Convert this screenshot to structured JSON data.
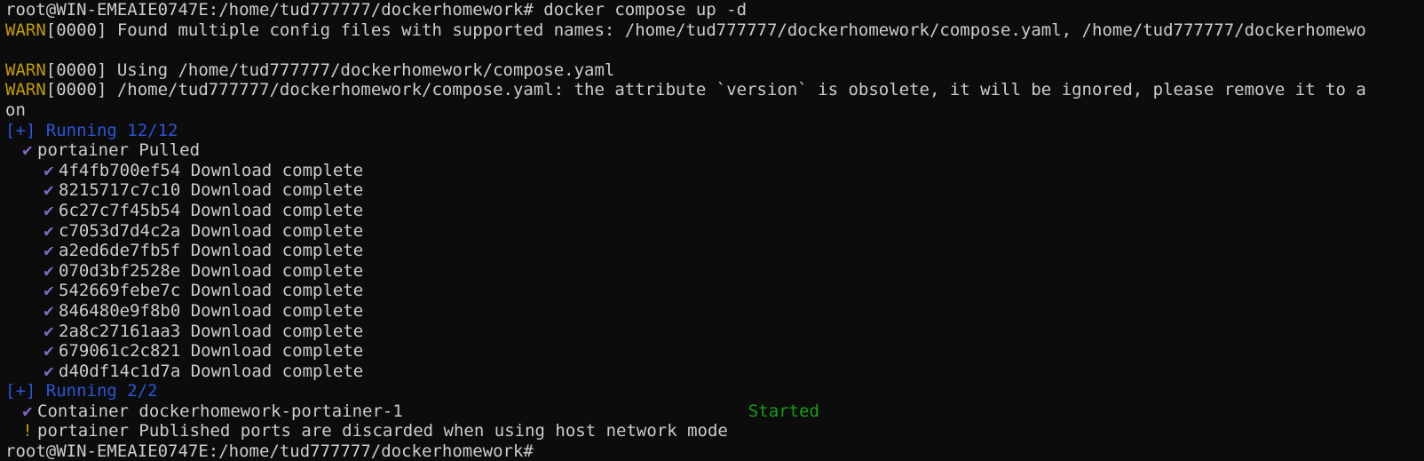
{
  "terminal": {
    "prompt": "root@WIN-EMEAIE0747E:/home/tud777777/dockerhomework#",
    "command": "docker compose up -d",
    "warn_label": "WARN",
    "warn_code": "[0000]",
    "warn1": "Found multiple config files with supported names: /home/tud777777/dockerhomework/compose.yaml, /home/tud777777/dockerhomewo",
    "warn2": "Using /home/tud777777/dockerhomework/compose.yaml",
    "warn3": "/home/tud777777/dockerhomework/compose.yaml: the attribute `version` is obsolete, it will be ignored, please remove it to a",
    "wrap": "on",
    "running1": "[+] Running 12/12",
    "pulled": "portainer Pulled",
    "layers": [
      {
        "id": "4f4fb700ef54",
        "status": "Download complete"
      },
      {
        "id": "8215717c7c10",
        "status": "Download complete"
      },
      {
        "id": "6c27c7f45b54",
        "status": "Download complete"
      },
      {
        "id": "c7053d7d4c2a",
        "status": "Download complete"
      },
      {
        "id": "a2ed6de7fb5f",
        "status": "Download complete"
      },
      {
        "id": "070d3bf2528e",
        "status": "Download complete"
      },
      {
        "id": "542669febe7c",
        "status": "Download complete"
      },
      {
        "id": "846480e9f8b0",
        "status": "Download complete"
      },
      {
        "id": "2a8c27161aa3",
        "status": "Download complete"
      },
      {
        "id": "679061c2c821",
        "status": "Download complete"
      },
      {
        "id": "d40df14c1d7a",
        "status": "Download complete"
      }
    ],
    "running2": "[+] Running 2/2",
    "container": "Container dockerhomework-portainer-1",
    "started": "Started",
    "notice_mark": "!",
    "notice": "portainer Published ports are discarded when using host network mode",
    "final_prompt": "root@WIN-EMEAIE0747E:/home/tud777777/dockerhomework#"
  },
  "icons": {
    "check": "check-icon",
    "notice": "exclamation-icon"
  },
  "colors": {
    "warn": "#c19c00",
    "running": "#2a55d6",
    "started": "#13a10e",
    "check": "#8764c8"
  }
}
